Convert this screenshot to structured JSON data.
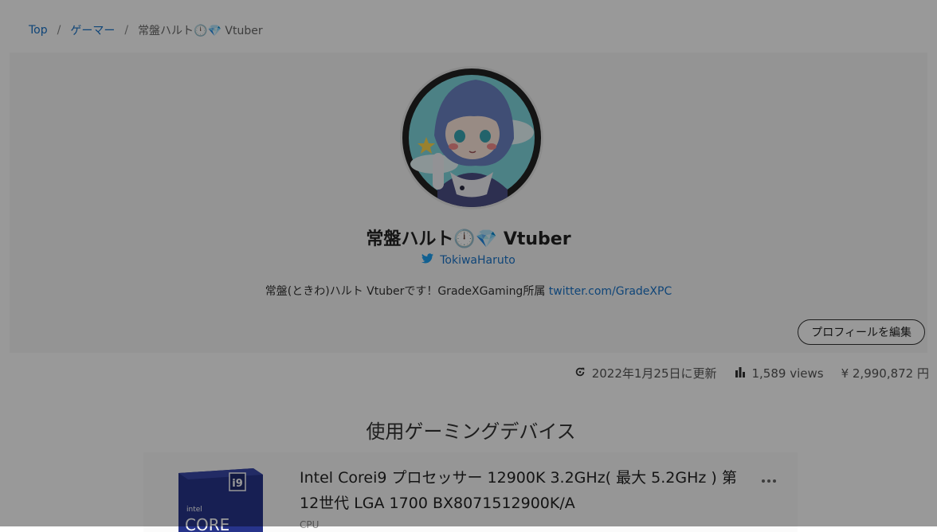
{
  "breadcrumb": {
    "items": [
      "Top",
      "ゲーマー"
    ],
    "separator": "/",
    "current": "常盤ハルト🕛💎 Vtuber"
  },
  "profile": {
    "name": "常盤ハルト🕛💎 Vtuber",
    "twitter_handle": "TokiwaHaruto",
    "bio_text": "常盤(ときわ)ハルト Vtuberです！GradeXGaming所属 ",
    "bio_link": "twitter.com/GradeXPC",
    "edit_button": "プロフィールを編集"
  },
  "stats": {
    "updated": "2022年1月25日に更新",
    "views": "1,589 views",
    "price": "¥ 2,990,872 円"
  },
  "section": {
    "title": "使用ゲーミングデバイス"
  },
  "device": {
    "title": "Intel Corei9 プロセッサー 12900K 3.2GHz( 最大 5.2GHz ) 第12世代 LGA 1700 BX8071512900K/A",
    "category": "CPU",
    "box_label": "i9",
    "box_brand": "intel",
    "box_product": "CORE"
  },
  "colors": {
    "link": "#1a73c8",
    "overlay": "rgba(0,0,0,0.4)",
    "card_bg": "#f7f7f7"
  }
}
